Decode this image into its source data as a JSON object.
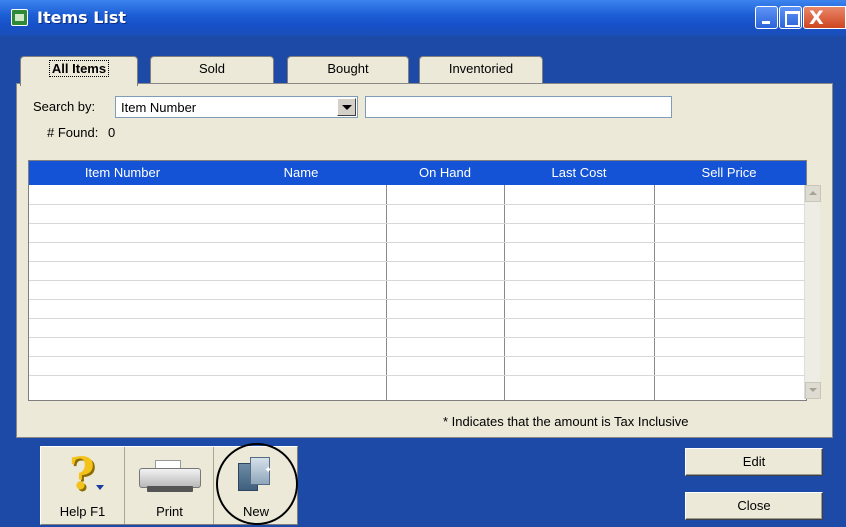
{
  "window": {
    "title": "Items List",
    "close_glyph": "X"
  },
  "tabs": [
    {
      "label": "All Items",
      "active": true
    },
    {
      "label": "Sold",
      "active": false
    },
    {
      "label": "Bought",
      "active": false
    },
    {
      "label": "Inventoried",
      "active": false
    }
  ],
  "search": {
    "label": "Search by:",
    "field_value": "Item Number",
    "text_value": "",
    "found_label": "# Found:",
    "found_count": "0"
  },
  "list": {
    "columns": [
      "Item Number",
      "Name",
      "On Hand",
      "Last Cost",
      "Sell Price"
    ],
    "rows": []
  },
  "note": "* Indicates that the amount is Tax Inclusive",
  "toolbar": {
    "help_label": "Help F1",
    "print_label": "Print",
    "new_label": "New"
  },
  "buttons": {
    "edit_label": "Edit",
    "close_label": "Close"
  },
  "icons": {
    "help": "question-mark-icon",
    "print": "printer-icon",
    "new": "new-item-icon"
  },
  "colors": {
    "titlebar": "#1d5fd6",
    "list_header": "#1453d6",
    "panel": "#ece9d8",
    "background": "#1d4aa6"
  }
}
